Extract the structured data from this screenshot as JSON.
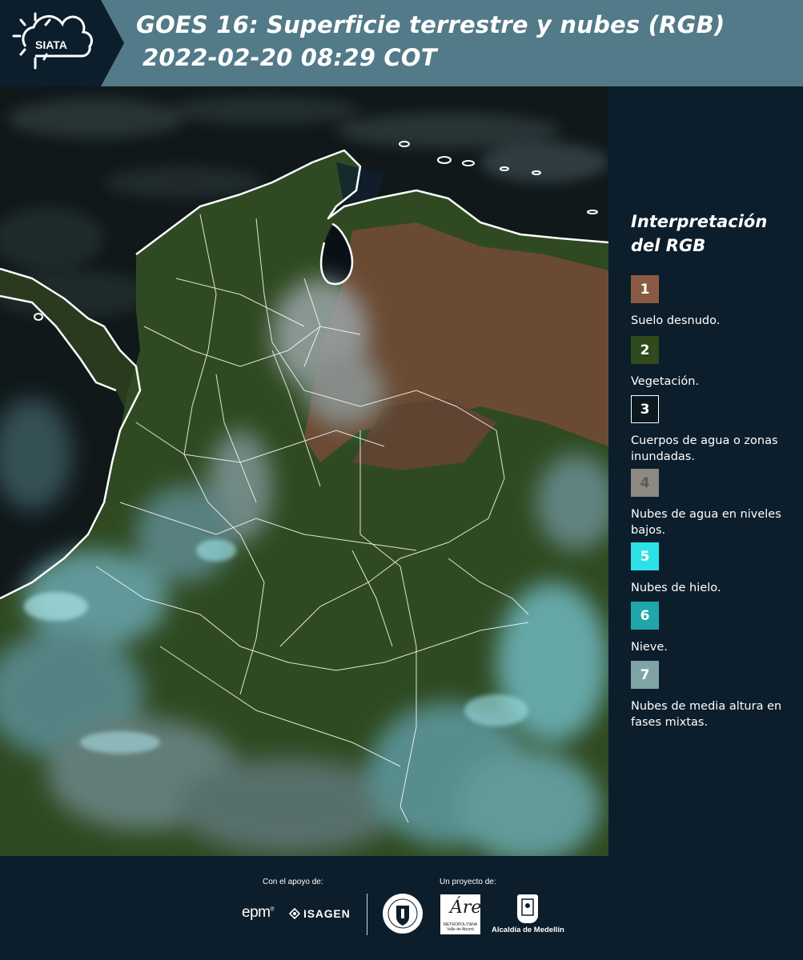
{
  "header": {
    "logo_text": "SIATA",
    "title_line1": "GOES 16: Superficie terrestre y nubes (RGB)",
    "title_line2": "2022-02-20 08:29 COT"
  },
  "legend": {
    "title": "Interpretación del RGB",
    "items": [
      {
        "number": "1",
        "label": "Suelo desnudo.",
        "color": "#8a5a44"
      },
      {
        "number": "2",
        "label": "Vegetación.",
        "color": "#2f4a1d"
      },
      {
        "number": "3",
        "label": "Cuerpos de agua o zonas inundadas.",
        "color": "#0c1820"
      },
      {
        "number": "4",
        "label": "Nubes de agua en niveles bajos.",
        "color": "#8c8882"
      },
      {
        "number": "5",
        "label": "Nubes de hielo.",
        "color": "#2de2e6"
      },
      {
        "number": "6",
        "label": "Nieve.",
        "color": "#1fa6aa"
      },
      {
        "number": "7",
        "label": "Nubes de media altura en fases mixtas.",
        "color": "#7fa4a6"
      }
    ]
  },
  "footer": {
    "support_label": "Con el apoyo de:",
    "project_label": "Un proyecto de:",
    "epm": "epm",
    "isagen": "ISAGEN",
    "area_big": "Área",
    "area_small": "METROPOLITANA Valle de Aburrá",
    "alcaldia": "Alcaldía de Medellín"
  },
  "colors": {
    "header_bg": "#527a88",
    "panel_bg": "#0c1e2b",
    "ocean": "#0f1714",
    "vegetation": "#2f4a24",
    "bare_soil": "#6a4630",
    "ice_cloud": "#6fd6dc",
    "low_cloud": "#9a9a94",
    "borders": "#ffffff"
  }
}
